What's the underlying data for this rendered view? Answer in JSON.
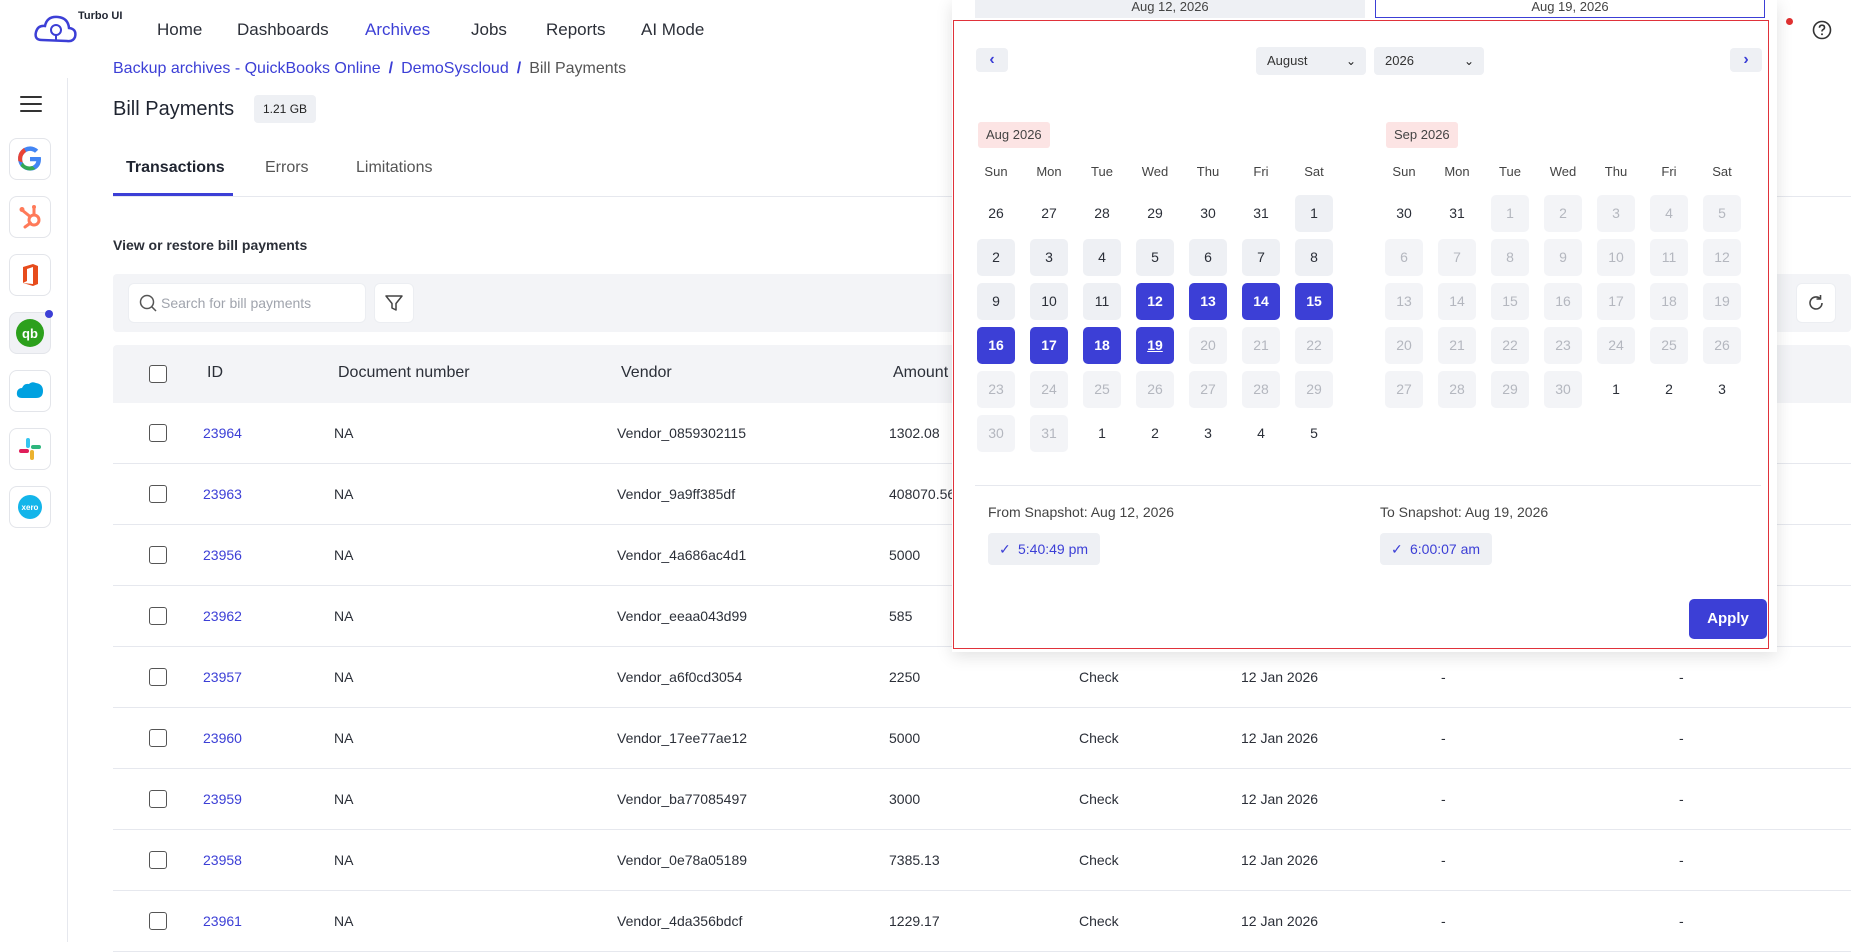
{
  "brand": {
    "name": "Turbo UI"
  },
  "nav": {
    "items": [
      "Home",
      "Dashboards",
      "Archives",
      "Jobs",
      "Reports",
      "AI Mode"
    ],
    "active": "Archives"
  },
  "sidebar": {
    "apps": [
      {
        "name": "google",
        "label": "G",
        "color": "#4285F4"
      },
      {
        "name": "hubspot",
        "label": "✱",
        "color": "#ff7a59"
      },
      {
        "name": "office",
        "label": "O",
        "color": "#e74c1c"
      },
      {
        "name": "quickbooks",
        "label": "qb",
        "color": "#2ca01c"
      },
      {
        "name": "salesforce",
        "label": "☁",
        "color": "#00a1e0"
      },
      {
        "name": "slack",
        "label": "#",
        "color": "#e01e5a"
      },
      {
        "name": "xero",
        "label": "xero",
        "color": "#13b5ea"
      }
    ]
  },
  "breadcrumb": {
    "items": [
      "Backup archives -  QuickBooks Online",
      "DemoSyscloud",
      "Bill Payments"
    ]
  },
  "page": {
    "title": "Bill Payments",
    "size": "1.21 GB"
  },
  "tabs": [
    "Transactions",
    "Errors",
    "Limitations"
  ],
  "section": {
    "label": "View or restore bill payments"
  },
  "search": {
    "placeholder": "Search for bill payments"
  },
  "table": {
    "columns": [
      "ID",
      "Document number",
      "Vendor",
      "Amount"
    ],
    "rows": [
      {
        "id": "23964",
        "doc": "NA",
        "vendor": "Vendor_0859302115",
        "amount": "1302.08",
        "type": "",
        "date": "",
        "c1": "",
        "c2": ""
      },
      {
        "id": "23963",
        "doc": "NA",
        "vendor": "Vendor_9a9ff385df",
        "amount": "408070.56",
        "type": "",
        "date": "",
        "c1": "",
        "c2": ""
      },
      {
        "id": "23956",
        "doc": "NA",
        "vendor": "Vendor_4a686ac4d1",
        "amount": "5000",
        "type": "",
        "date": "",
        "c1": "",
        "c2": ""
      },
      {
        "id": "23962",
        "doc": "NA",
        "vendor": "Vendor_eeaa043d99",
        "amount": "585",
        "type": "",
        "date": "",
        "c1": "",
        "c2": ""
      },
      {
        "id": "23957",
        "doc": "NA",
        "vendor": "Vendor_a6f0cd3054",
        "amount": "2250",
        "type": "Check",
        "date": "12 Jan 2026",
        "c1": "-",
        "c2": "-"
      },
      {
        "id": "23960",
        "doc": "NA",
        "vendor": "Vendor_17ee77ae12",
        "amount": "5000",
        "type": "Check",
        "date": "12 Jan 2026",
        "c1": "-",
        "c2": "-"
      },
      {
        "id": "23959",
        "doc": "NA",
        "vendor": "Vendor_ba77085497",
        "amount": "3000",
        "type": "Check",
        "date": "12 Jan 2026",
        "c1": "-",
        "c2": "-"
      },
      {
        "id": "23958",
        "doc": "NA",
        "vendor": "Vendor_0e78a05189",
        "amount": "7385.13",
        "type": "Check",
        "date": "12 Jan 2026",
        "c1": "-",
        "c2": "-"
      },
      {
        "id": "23961",
        "doc": "NA",
        "vendor": "Vendor_4da356bdcf",
        "amount": "1229.17",
        "type": "Check",
        "date": "12 Jan 2026",
        "c1": "-",
        "c2": "-"
      }
    ]
  },
  "picker": {
    "from_top": "Aug 12, 2026",
    "to_top": "Aug 19, 2026",
    "month_select": "August",
    "year_select": "2026",
    "left_month": "Aug 2026",
    "right_month": "Sep 2026",
    "weekdays": [
      "Sun",
      "Mon",
      "Tue",
      "Wed",
      "Thu",
      "Fri",
      "Sat"
    ],
    "left_days": [
      [
        "26",
        "out"
      ],
      [
        "27",
        "out"
      ],
      [
        "28",
        "out"
      ],
      [
        "29",
        "out"
      ],
      [
        "30",
        "out"
      ],
      [
        "31",
        "out"
      ],
      [
        "1",
        "in"
      ],
      [
        "2",
        "in"
      ],
      [
        "3",
        "in"
      ],
      [
        "4",
        "in"
      ],
      [
        "5",
        "in"
      ],
      [
        "6",
        "in"
      ],
      [
        "7",
        "in"
      ],
      [
        "8",
        "in"
      ],
      [
        "9",
        "in"
      ],
      [
        "10",
        "in"
      ],
      [
        "11",
        "in"
      ],
      [
        "12",
        "hl"
      ],
      [
        "13",
        "hl"
      ],
      [
        "14",
        "hl"
      ],
      [
        "15",
        "hl"
      ],
      [
        "16",
        "hl"
      ],
      [
        "17",
        "hl"
      ],
      [
        "18",
        "hl"
      ],
      [
        "19",
        "hl today"
      ],
      [
        "20",
        "dim"
      ],
      [
        "21",
        "dim"
      ],
      [
        "22",
        "dim"
      ],
      [
        "23",
        "dim"
      ],
      [
        "24",
        "dim"
      ],
      [
        "25",
        "dim"
      ],
      [
        "26",
        "dim"
      ],
      [
        "27",
        "dim"
      ],
      [
        "28",
        "dim"
      ],
      [
        "29",
        "dim"
      ],
      [
        "30",
        "dim"
      ],
      [
        "31",
        "dim"
      ],
      [
        "1",
        "out"
      ],
      [
        "2",
        "out"
      ],
      [
        "3",
        "out"
      ],
      [
        "4",
        "out"
      ],
      [
        "5",
        "out"
      ]
    ],
    "right_days": [
      [
        "30",
        "out"
      ],
      [
        "31",
        "out"
      ],
      [
        "1",
        "dim"
      ],
      [
        "2",
        "dim"
      ],
      [
        "3",
        "dim"
      ],
      [
        "4",
        "dim"
      ],
      [
        "5",
        "dim"
      ],
      [
        "6",
        "dim"
      ],
      [
        "7",
        "dim"
      ],
      [
        "8",
        "dim"
      ],
      [
        "9",
        "dim"
      ],
      [
        "10",
        "dim"
      ],
      [
        "11",
        "dim"
      ],
      [
        "12",
        "dim"
      ],
      [
        "13",
        "dim"
      ],
      [
        "14",
        "dim"
      ],
      [
        "15",
        "dim"
      ],
      [
        "16",
        "dim"
      ],
      [
        "17",
        "dim"
      ],
      [
        "18",
        "dim"
      ],
      [
        "19",
        "dim"
      ],
      [
        "20",
        "dim"
      ],
      [
        "21",
        "dim"
      ],
      [
        "22",
        "dim"
      ],
      [
        "23",
        "dim"
      ],
      [
        "24",
        "dim"
      ],
      [
        "25",
        "dim"
      ],
      [
        "26",
        "dim"
      ],
      [
        "27",
        "dim"
      ],
      [
        "28",
        "dim"
      ],
      [
        "29",
        "dim"
      ],
      [
        "30",
        "dim"
      ],
      [
        "1",
        "out"
      ],
      [
        "2",
        "out"
      ],
      [
        "3",
        "out"
      ]
    ],
    "from_label": "From Snapshot: Aug 12, 2026",
    "to_label": "To Snapshot: Aug 19, 2026",
    "from_time": "5:40:49 pm",
    "to_time": "6:00:07 am",
    "apply_label": "Apply"
  }
}
